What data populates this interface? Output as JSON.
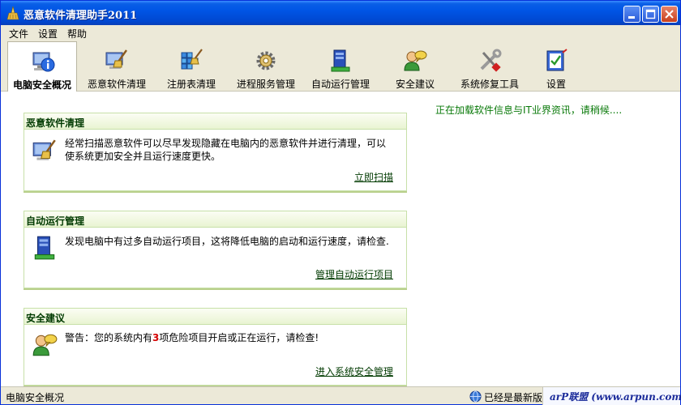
{
  "window": {
    "title": "恶意软件清理助手2011"
  },
  "menu": [
    "文件",
    "设置",
    "帮助"
  ],
  "toolbar": [
    {
      "label": "电脑安全概况",
      "icon": "computer-info-icon",
      "active": true
    },
    {
      "label": "恶意软件清理",
      "icon": "malware-clean-icon",
      "active": false
    },
    {
      "label": "注册表清理",
      "icon": "registry-clean-icon",
      "active": false
    },
    {
      "label": "进程服务管理",
      "icon": "process-service-icon",
      "active": false
    },
    {
      "label": "自动运行管理",
      "icon": "autorun-manage-icon",
      "active": false
    },
    {
      "label": "安全建议",
      "icon": "security-advice-icon",
      "active": false
    },
    {
      "label": "系统修复工具",
      "icon": "repair-tools-icon",
      "active": false
    },
    {
      "label": "设置",
      "icon": "settings-icon",
      "active": false
    }
  ],
  "panels": {
    "malware": {
      "title": "恶意软件清理",
      "text_line1": "经常扫描恶意软件可以尽早发现隐藏在电脑内的恶意软件并进行清理，可以",
      "text_line2": "使系统更加安全并且运行速度更快。",
      "link": "立即扫描"
    },
    "autorun": {
      "title": "自动运行管理",
      "text": "发现电脑中有过多自动运行项目，这将降低电脑的启动和运行速度，请检查.",
      "link": "管理自动运行项目"
    },
    "security": {
      "title": "安全建议",
      "text_prefix": "警告：您的系统内有",
      "count": "3",
      "text_suffix": "项危险项目开启或正在运行，请检查!",
      "link": "进入系统安全管理"
    }
  },
  "news": "正在加载软件信息与IT业界资讯，请稍候....",
  "status": {
    "left": "电脑安全概况",
    "version": "已经是最新版",
    "link": "arP联盟 (www.arpun.com)"
  },
  "colors": {
    "title_bar": "#0055e5",
    "panel_border": "#c7e0a8",
    "link_green": "#003a00",
    "news_green": "#0a7a0a",
    "warning_red": "#d40000"
  }
}
